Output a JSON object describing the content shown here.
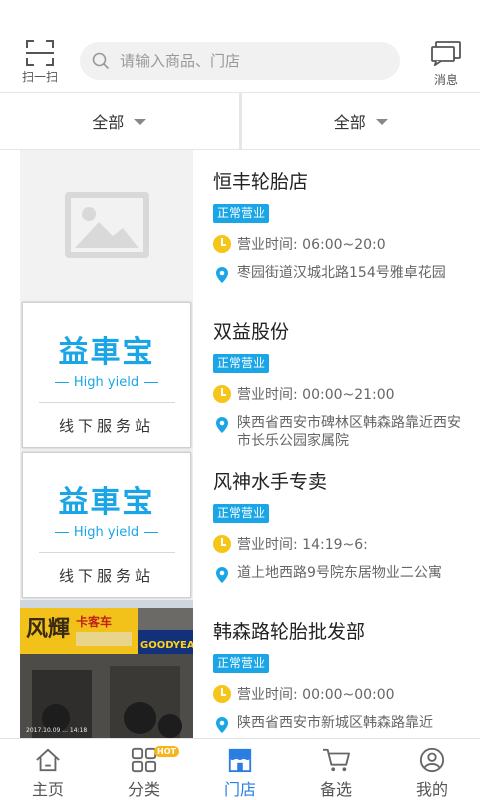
{
  "header": {
    "scan_label": "扫一扫",
    "search_placeholder": "请输入商品、门店",
    "message_label": "消息"
  },
  "filters": [
    {
      "label": "全部"
    },
    {
      "label": "全部"
    }
  ],
  "stores": [
    {
      "name": "恒丰轮胎店",
      "status": "正常营业",
      "hours": "营业时间: 06:00~20:0",
      "address": "枣园街道汉城北路154号雅卓花园",
      "thumb": "placeholder"
    },
    {
      "name": "双益股份",
      "status": "正常营业",
      "hours": "营业时间: 00:00~21:00",
      "address": "陕西省西安市碑林区韩森路靠近西安市长乐公园家属院",
      "thumb": "logo"
    },
    {
      "name": "风神水手专卖",
      "status": "正常营业",
      "hours": "营业时间: 14:19~6:",
      "address": "道上地西路9号院东居物业二公寓",
      "thumb": "logo"
    },
    {
      "name": "韩森路轮胎批发部",
      "status": "正常营业",
      "hours": "营业时间: 00:00~00:00",
      "address": "陕西省西安市新城区韩森路靠近",
      "thumb": "photo"
    }
  ],
  "logo_card": {
    "brand": "益車宝",
    "tagline": "High yield",
    "subtitle": "线下服务站"
  },
  "photo_sign": {
    "shop_sign": "风輝",
    "shop_sub": "卡客车",
    "brand_sign": "GOODYEAR",
    "caption": "2017.10.09 ... 14:18"
  },
  "tabs": [
    {
      "label": "主页",
      "icon": "home-icon"
    },
    {
      "label": "分类",
      "icon": "category-icon",
      "badge": "HOT"
    },
    {
      "label": "门店",
      "icon": "store-icon",
      "active": true
    },
    {
      "label": "备选",
      "icon": "cart-icon"
    },
    {
      "label": "我的",
      "icon": "profile-icon"
    }
  ],
  "colors": {
    "accent": "#1aa6e6",
    "active_tab": "#2a7de1",
    "clock": "#f5c518",
    "badge": "#1aa6e6"
  }
}
